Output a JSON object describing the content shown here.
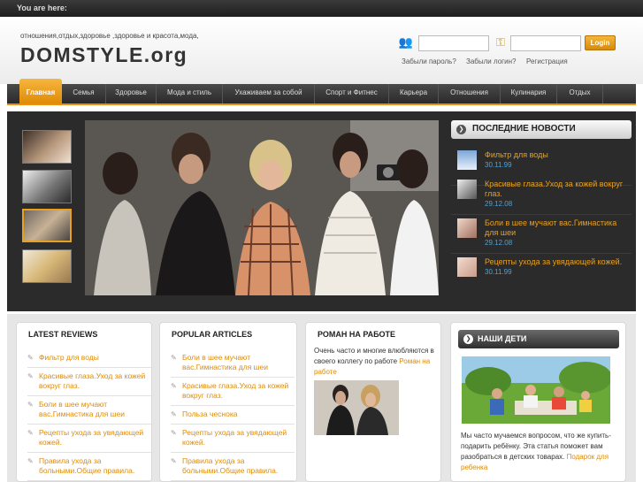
{
  "topbar": {
    "breadcrumb_label": "You are here:"
  },
  "header": {
    "tagline": "отношения,отдых,здоровье ,здоровье и красота,мода,",
    "logo": "DOMSTYLE.org",
    "login_button": "Login",
    "links": [
      "Забыли пароль?",
      "Забыли логин?",
      "Регистрация"
    ]
  },
  "nav": {
    "items": [
      "Главная",
      "Семья",
      "Здоровье",
      "Мода и стиль",
      "Ухаживаем за собой",
      "Спорт и Фитнес",
      "Карьера",
      "Отношения",
      "Кулинария",
      "Отдых"
    ],
    "active": "Главная"
  },
  "news": {
    "title": "ПОСЛЕДНИЕ НОВОСТИ",
    "items": [
      {
        "title": "Фильтр для воды",
        "date": "30.11.99"
      },
      {
        "title": "Красивые глаза.Уход за кожей вокруг глаз.",
        "date": "29.12.08"
      },
      {
        "title": "Боли в шее мучают вас.Гимнастика для шеи",
        "date": "29.12.08"
      },
      {
        "title": "Рецепты ухода за увядающей кожей.",
        "date": "30.11.99"
      }
    ]
  },
  "latest_reviews": {
    "title": "LATEST REVIEWS",
    "items": [
      "Фильтр для воды",
      "Красивые глаза.Уход за кожей вокруг глаз.",
      "Боли в шее мучают вас.Гимнастика для шеи",
      "Рецепты ухода за увядающей кожей.",
      "Правила ухода за больными.Общие правила."
    ]
  },
  "popular_articles": {
    "title": "POPULAR ARTICLES",
    "items": [
      "Боли в шее мучают вас.Гимнастика для шеи",
      "Красивые глаза.Уход за кожей вокруг глаз.",
      "Польза чеснока",
      "Рецепты ухода за увядающей кожей.",
      "Правила ухода за больными.Общие правила."
    ]
  },
  "romance": {
    "title": "РОМАН НА РАБОТЕ",
    "text": "Очень часто и многие влюбляются в своего коллегу по работе",
    "link": "Роман на работе"
  },
  "kids": {
    "title": "НАШИ ДЕТИ",
    "text": "Мы часто мучаемся вопросом, что же купить-подарить ребёнку. Эта статья поможет вам разобраться в детских товарах.",
    "link": "Подарок для ребенка"
  },
  "colors": {
    "accent": "#e9900f",
    "link": "#e08b07",
    "date": "#4aa3d8",
    "dark_panel": "#2b2b2b"
  }
}
